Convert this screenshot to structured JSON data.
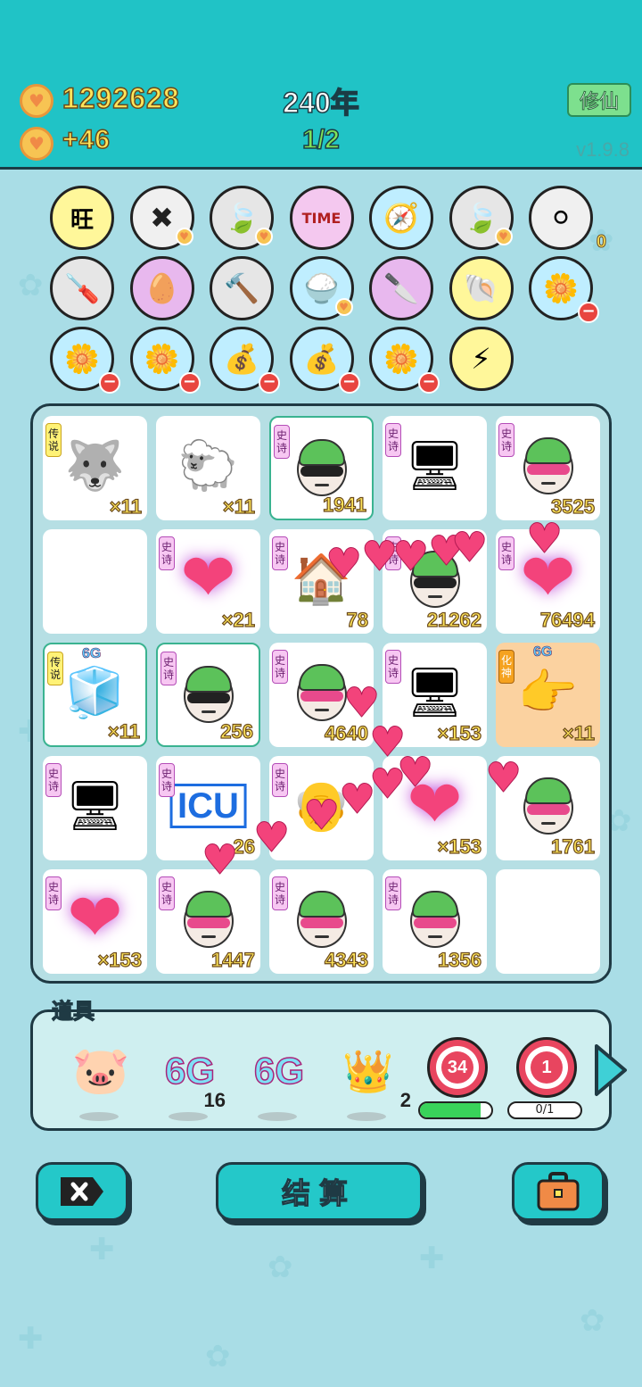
{
  "header": {
    "coins": "1292628",
    "income": "+46",
    "year": "240年",
    "progress": "1/2",
    "cultivate_label": "修仙",
    "version": "v1.9.8",
    "coin_icon": "heart-coin-icon"
  },
  "inventory": {
    "rows": [
      [
        {
          "icon": "wang-tiles-icon",
          "glyph": "旺",
          "bg": "#fff79a"
        },
        {
          "icon": "delete-tag-icon",
          "glyph": "✖",
          "bg": "#f0f0f0",
          "heart": true
        },
        {
          "icon": "leaf-icon",
          "glyph": "🍃",
          "bg": "#e6e6e6",
          "heart": true
        },
        {
          "icon": "time-magazine-icon",
          "glyph": "TIME",
          "bg": "#f4c8ef"
        },
        {
          "icon": "compass-icon",
          "glyph": "🧭",
          "bg": "#bfeeff"
        },
        {
          "icon": "leaf-icon",
          "glyph": "🍃",
          "bg": "#e6e6e6",
          "heart": true
        },
        {
          "icon": "egg-tray-icon",
          "glyph": "⚪",
          "bg": "#f0f0f0",
          "zero": "0"
        }
      ],
      [
        {
          "icon": "screwdriver-icon",
          "glyph": "🪛",
          "bg": "#e6e6e6"
        },
        {
          "icon": "egg-face-icon",
          "glyph": "🥚",
          "bg": "#e8b8ee"
        },
        {
          "icon": "hammer-icon",
          "glyph": "🔨",
          "bg": "#e6e6e6"
        },
        {
          "icon": "rice-bowl-icon",
          "glyph": "🍚",
          "bg": "#bfeeff",
          "heart": true
        },
        {
          "icon": "cleaver-icon",
          "glyph": "🔪",
          "bg": "#e8b8ee"
        },
        {
          "icon": "shell-icon",
          "glyph": "🐚",
          "bg": "#fff79a"
        },
        {
          "icon": "flower-pot-icon",
          "glyph": "🌼",
          "bg": "#bfeeff",
          "minus": true
        }
      ],
      [
        {
          "icon": "flower-pot-icon",
          "glyph": "🌼",
          "bg": "#bfeeff",
          "minus": true
        },
        {
          "icon": "flower-pot-icon",
          "glyph": "🌼",
          "bg": "#bfeeff",
          "minus": true
        },
        {
          "icon": "money-bag-icon",
          "glyph": "💰",
          "bg": "#bfeeff",
          "minus": true
        },
        {
          "icon": "money-bag-icon",
          "glyph": "💰",
          "bg": "#bfeeff",
          "minus": true
        },
        {
          "icon": "flower-pot-icon",
          "glyph": "🌼",
          "bg": "#bfeeff",
          "minus": true
        },
        {
          "icon": "lightning-icon",
          "glyph": "⚡",
          "bg": "#fff79a"
        }
      ]
    ]
  },
  "board": {
    "cells": [
      {
        "tag": "传说",
        "tag_type": "legend",
        "art": "husky-crown",
        "glyph": "🐺",
        "count": "×11"
      },
      {
        "tag": "",
        "art": "sheep",
        "glyph": "🐑",
        "count": "×11"
      },
      {
        "tag": "史诗",
        "tag_type": "epic",
        "art": "face-black",
        "count": "1941",
        "hl": true
      },
      {
        "tag": "史诗",
        "tag_type": "epic",
        "art": "gpu-card",
        "glyph": "🖥",
        "count": ""
      },
      {
        "tag": "史诗",
        "tag_type": "epic",
        "art": "face-pink",
        "count": "3525"
      },
      {
        "tag": "",
        "art": "empty",
        "count": ""
      },
      {
        "tag": "史诗",
        "tag_type": "epic",
        "art": "heart-glow",
        "glyph": "❤",
        "count": "×21"
      },
      {
        "tag": "史诗",
        "tag_type": "epic",
        "art": "rabbit-house",
        "glyph": "🏠",
        "count": "78"
      },
      {
        "tag": "史诗",
        "tag_type": "epic",
        "art": "face-black",
        "count": "21262"
      },
      {
        "tag": "史诗",
        "tag_type": "epic",
        "art": "heart-glow",
        "glyph": "❤",
        "count": "76494"
      },
      {
        "tag": "传说",
        "tag_type": "legend",
        "art": "fridge-crown",
        "glyph": "🧊",
        "count": "×11",
        "hl": true,
        "sixg": "6G"
      },
      {
        "tag": "史诗",
        "tag_type": "epic",
        "art": "face-black",
        "count": "256",
        "hl": true
      },
      {
        "tag": "史诗",
        "tag_type": "epic",
        "art": "face-pink",
        "count": "4640"
      },
      {
        "tag": "史诗",
        "tag_type": "epic",
        "art": "gpu-card",
        "glyph": "🖥",
        "count": "×153"
      },
      {
        "tag": "化神",
        "tag_type": "hua",
        "art": "pointing-hand",
        "glyph": "👉",
        "count": "×11",
        "orange": true,
        "sixg": "6G"
      },
      {
        "tag": "史诗",
        "tag_type": "epic",
        "art": "gpu-card",
        "glyph": "🖥",
        "count": ""
      },
      {
        "tag": "史诗",
        "tag_type": "epic",
        "art": "icu-sign",
        "glyph": "ICU",
        "count": "26"
      },
      {
        "tag": "史诗",
        "tag_type": "epic",
        "art": "old-face",
        "glyph": "👴",
        "count": ""
      },
      {
        "tag": "",
        "art": "heart-glow",
        "glyph": "❤",
        "count": "×153"
      },
      {
        "tag": "",
        "art": "face-pink",
        "count": "1761"
      },
      {
        "tag": "史诗",
        "tag_type": "epic",
        "art": "heart-glow",
        "glyph": "❤",
        "count": "×153"
      },
      {
        "tag": "史诗",
        "tag_type": "epic",
        "art": "face-pink",
        "count": "1447"
      },
      {
        "tag": "史诗",
        "tag_type": "epic",
        "art": "face-pink",
        "count": "4343"
      },
      {
        "tag": "史诗",
        "tag_type": "epic",
        "art": "face-pink",
        "count": "1356"
      },
      {
        "tag": "",
        "art": "empty",
        "count": ""
      }
    ]
  },
  "tools": {
    "title": "道具",
    "items": [
      {
        "name": "piggy-bank",
        "glyph": "🐷",
        "sub": ""
      },
      {
        "name": "6g-a",
        "label": "6G",
        "sub": "16"
      },
      {
        "name": "6g-b",
        "label": "6G",
        "sub": ""
      },
      {
        "name": "crown",
        "glyph": "👑",
        "sub": "2"
      }
    ],
    "target_a": {
      "num": "34",
      "progress": 0.85
    },
    "target_b": {
      "num": "1",
      "label": "0/1",
      "progress": 0
    }
  },
  "buttons": {
    "delete_icon": "delete-tag-icon",
    "settle_label": "结算",
    "bag_icon": "briefcase-icon"
  },
  "colors": {
    "header_bg": "#20c3c6",
    "page_bg": "#a9dde6",
    "gold_text": "#ffe55a",
    "green_text": "#7ee35a"
  }
}
